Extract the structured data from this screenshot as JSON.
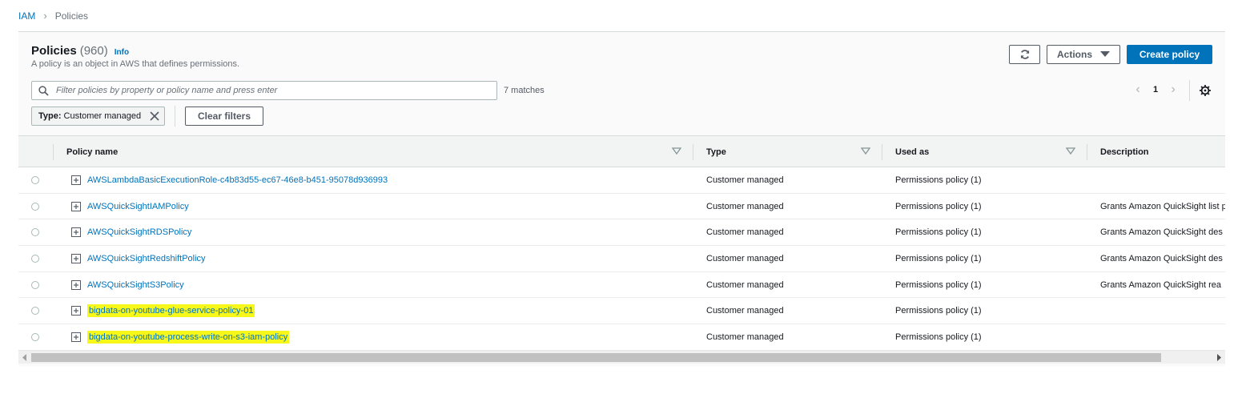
{
  "breadcrumb": {
    "root": "IAM",
    "separator": "›",
    "current": "Policies"
  },
  "header": {
    "title": "Policies",
    "count": "(960)",
    "info": "Info",
    "subtitle": "A policy is an object in AWS that defines permissions."
  },
  "toolbar": {
    "refresh_icon": "refresh-icon",
    "actions_label": "Actions",
    "create_label": "Create policy"
  },
  "search": {
    "placeholder": "Filter policies by property or policy name and press enter",
    "value": "",
    "matches": "7 matches"
  },
  "pagination": {
    "page": "1",
    "prev": "‹",
    "next": "›"
  },
  "filter": {
    "key": "Type:",
    "value": "Customer managed",
    "clear_label": "Clear filters"
  },
  "columns": [
    "Policy name",
    "Type",
    "Used as",
    "Description"
  ],
  "rows": [
    {
      "name": "AWSLambdaBasicExecutionRole-c4b83d55-ec67-46e8-b451-95078d936993",
      "type": "Customer managed",
      "used_as": "Permissions policy (1)",
      "description": "",
      "highlighted": false
    },
    {
      "name": "AWSQuickSightIAMPolicy",
      "type": "Customer managed",
      "used_as": "Permissions policy (1)",
      "description": "Grants Amazon QuickSight list p",
      "highlighted": false
    },
    {
      "name": "AWSQuickSightRDSPolicy",
      "type": "Customer managed",
      "used_as": "Permissions policy (1)",
      "description": "Grants Amazon QuickSight des",
      "highlighted": false
    },
    {
      "name": "AWSQuickSightRedshiftPolicy",
      "type": "Customer managed",
      "used_as": "Permissions policy (1)",
      "description": "Grants Amazon QuickSight des",
      "highlighted": false
    },
    {
      "name": "AWSQuickSightS3Policy",
      "type": "Customer managed",
      "used_as": "Permissions policy (1)",
      "description": "Grants Amazon QuickSight rea",
      "highlighted": false
    },
    {
      "name": "bigdata-on-youtube-glue-service-policy-01",
      "type": "Customer managed",
      "used_as": "Permissions policy (1)",
      "description": "",
      "highlighted": true
    },
    {
      "name": "bigdata-on-youtube-process-write-on-s3-iam-policy",
      "type": "Customer managed",
      "used_as": "Permissions policy (1)",
      "description": "",
      "highlighted": true
    }
  ],
  "colors": {
    "link": "#0073bb",
    "primary": "#0073bb",
    "highlight": "#f7f71a",
    "border": "#d5dbdb"
  }
}
